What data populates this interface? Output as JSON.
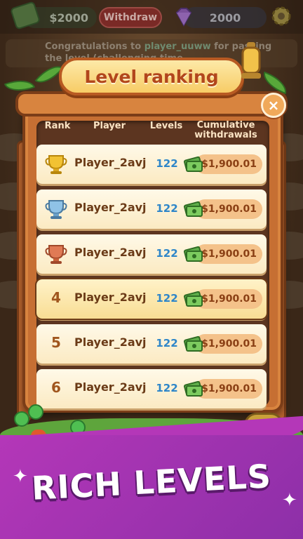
{
  "top_bar": {
    "cash": "$2000",
    "withdraw_label": "Withdraw",
    "gems": "2000"
  },
  "notice": {
    "prefix": "Congratulations to ",
    "highlight_name": "player_uuww",
    "suffix": " for passing the level (challenging time..."
  },
  "panel": {
    "title": "Level ranking",
    "close_label": "×"
  },
  "columns": {
    "rank": "Rank",
    "player": "Player",
    "levels": "Levels",
    "cumulative": "Cumulative withdrawals"
  },
  "rows": [
    {
      "rank": "",
      "trophy": "gold",
      "player": "Player_2avj",
      "levels": "122",
      "amount": "$1,900.01"
    },
    {
      "rank": "",
      "trophy": "silver",
      "player": "Player_2avj",
      "levels": "122",
      "amount": "$1,900.01"
    },
    {
      "rank": "",
      "trophy": "bronze",
      "player": "Player_2avj",
      "levels": "122",
      "amount": "$1,900.01"
    },
    {
      "rank": "4",
      "trophy": "",
      "player": "Player_2avj",
      "levels": "122",
      "amount": "$1,900.01"
    },
    {
      "rank": "5",
      "trophy": "",
      "player": "Player_2avj",
      "levels": "122",
      "amount": "$1,900.01"
    },
    {
      "rank": "6",
      "trophy": "",
      "player": "Player_2avj",
      "levels": "122",
      "amount": "$1,900.01"
    }
  ],
  "footer": {
    "tagline": "RICH LEVELS"
  },
  "colors": {
    "gold": "#f2c233",
    "silver": "#8fc2e6",
    "bronze": "#e07a55",
    "accent_blue": "#2e86c9",
    "brand_purple": "#b437b8"
  }
}
